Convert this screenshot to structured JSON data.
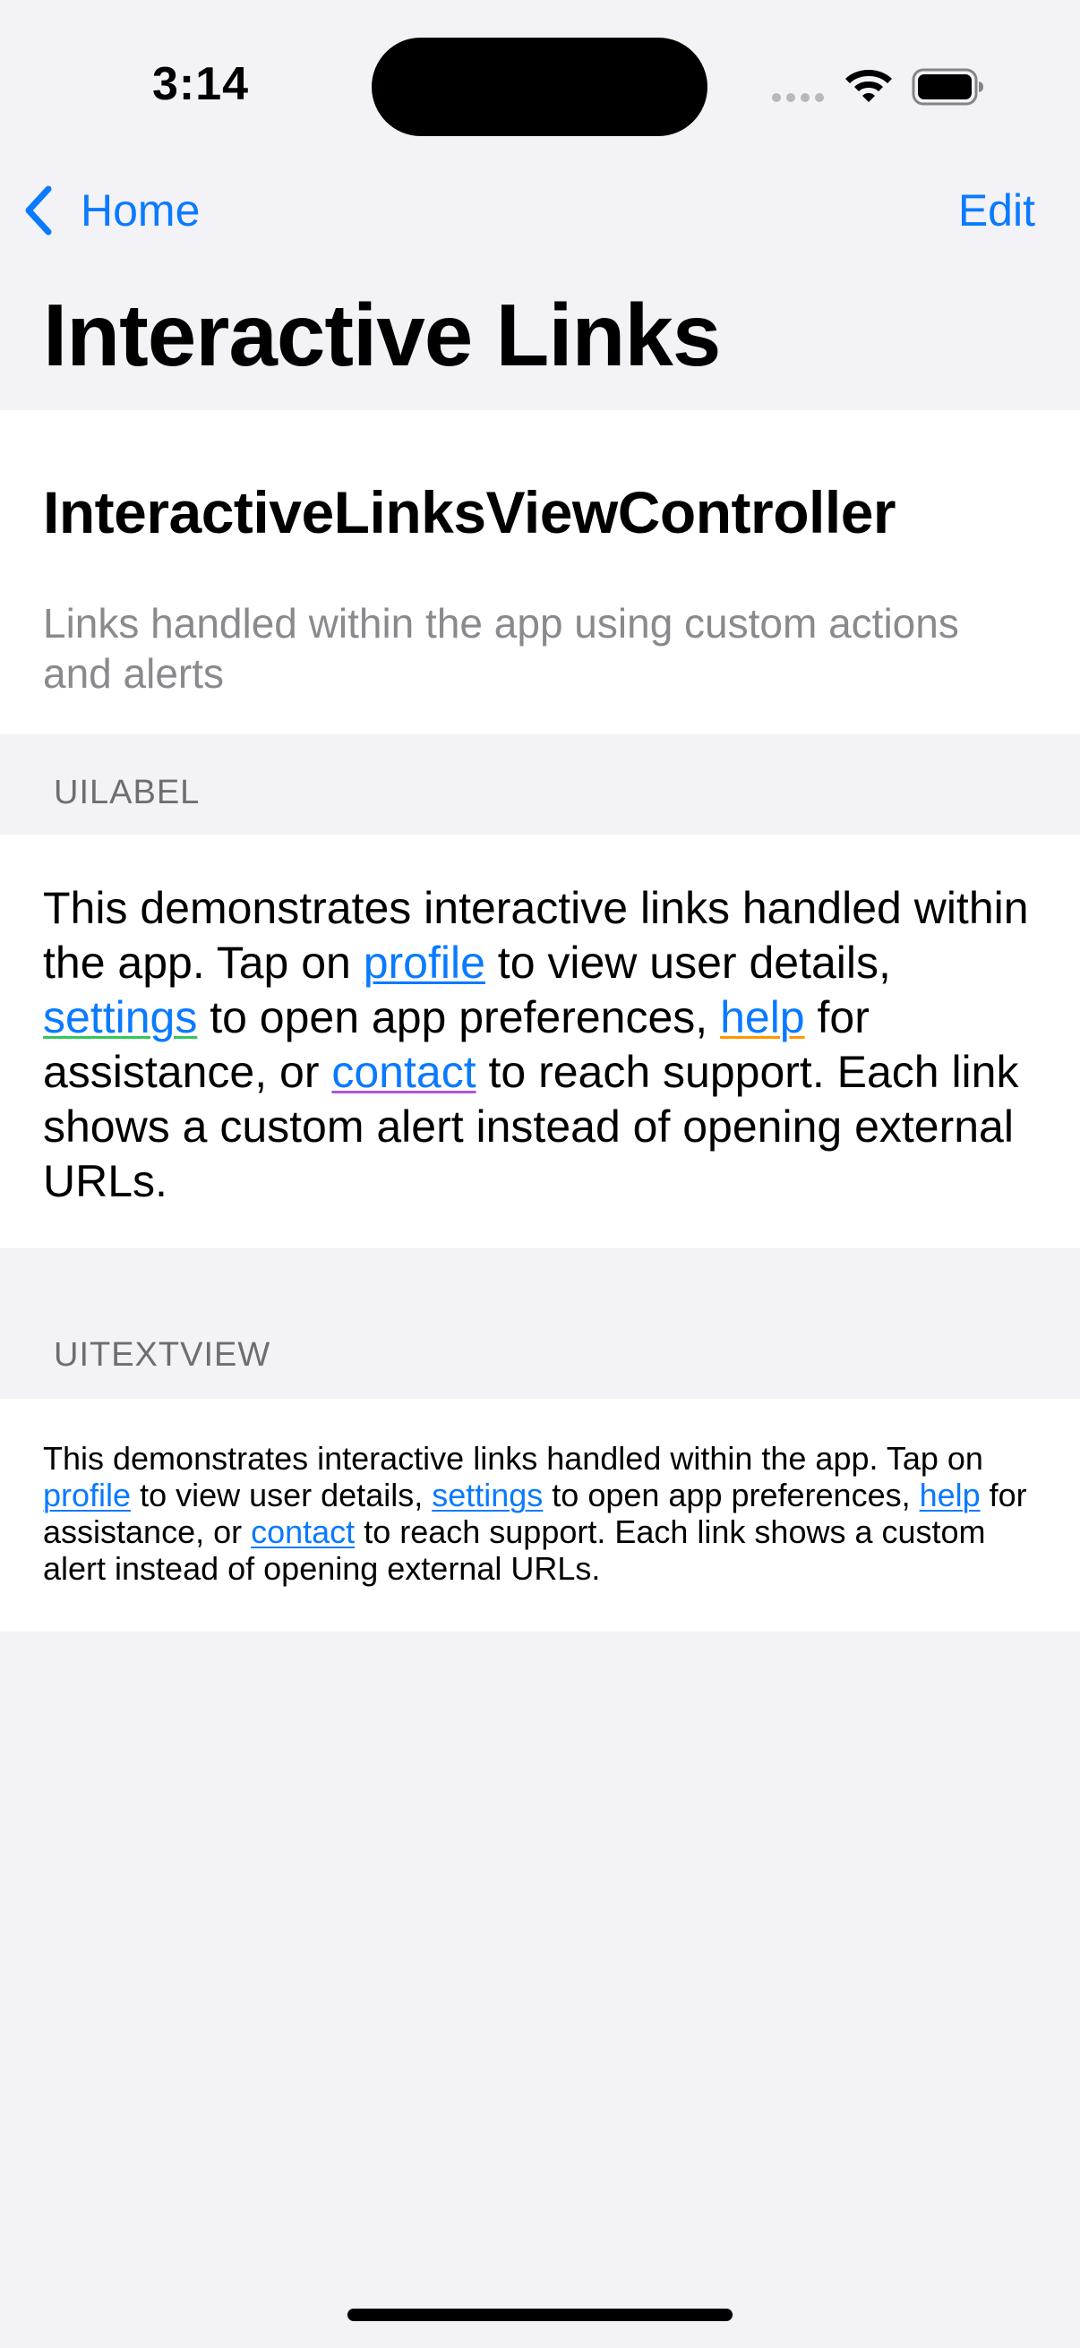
{
  "status_bar": {
    "time": "3:14"
  },
  "nav": {
    "back_label": "Home",
    "edit_label": "Edit",
    "title": "Interactive Links"
  },
  "header": {
    "controller_name": "InteractiveLinksViewController",
    "description": "Links handled within the app using custom actions and alerts"
  },
  "sections": {
    "label_header": "UILABEL",
    "textview_header": "UITEXTVIEW"
  },
  "body": {
    "part1": "This demonstrates interactive links handled within the app. Tap on ",
    "link_profile": "profile",
    "part2": " to view user details, ",
    "link_settings": "settings",
    "part3": " to open app preferences, ",
    "link_help": "help",
    "part4": " for assistance, or ",
    "link_contact": "contact",
    "part5": " to reach support. Each link shows a custom alert instead of opening external URLs."
  },
  "icons": {
    "back": "chevron-left-icon",
    "wifi": "wifi-icon",
    "battery": "battery-icon",
    "signal": "cellular-signal-icon"
  },
  "colors": {
    "accent": "#0A7AFF",
    "background": "#F2F2F7",
    "secondary_text": "#8A8A8E",
    "settings_underline": "#34C759",
    "help_underline": "#FF9500",
    "contact_underline": "#AF52DE"
  }
}
